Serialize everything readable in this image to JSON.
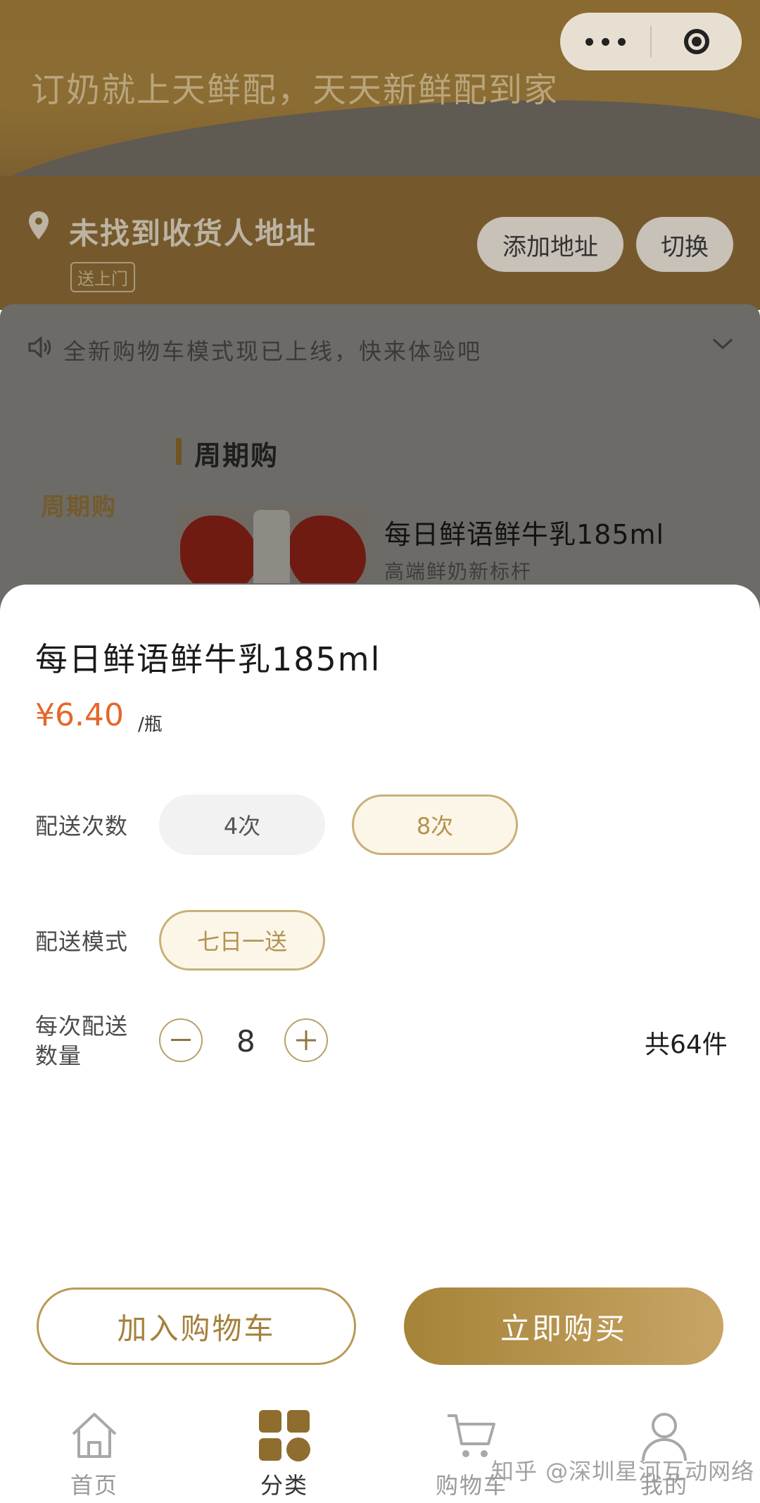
{
  "header": {
    "slogan": "订奶就上天鲜配，天天新鲜配到家",
    "capsule": {
      "more_icon": "more-dots-icon",
      "close_icon": "target-close-icon"
    }
  },
  "address": {
    "title": "未找到收货人地址",
    "tag": "送上门",
    "add_button": "添加地址",
    "switch_button": "切换"
  },
  "notice": {
    "text": "全新购物车模式现已上线，快来体验吧"
  },
  "category": {
    "left_item": "周期购",
    "section_title": "周期购",
    "product_name": "每日鲜语鲜牛乳185ml",
    "product_subtitle": "高端鲜奶新标杆"
  },
  "sheet": {
    "title": "每日鲜语鲜牛乳185ml",
    "price": "¥6.40",
    "unit": "/瓶",
    "delivery_times_label": "配送次数",
    "delivery_times_options": [
      {
        "label": "4次",
        "selected": false
      },
      {
        "label": "8次",
        "selected": true
      }
    ],
    "delivery_mode_label": "配送模式",
    "delivery_mode_option": "七日一送",
    "qty_label_line1": "每次配送",
    "qty_label_line2": "数量",
    "qty_value": "8",
    "qty_total": "共64件",
    "add_to_cart": "加入购物车",
    "buy_now": "立即购买"
  },
  "tabbar": {
    "items": [
      {
        "label": "首页",
        "icon": "home-icon",
        "active": false
      },
      {
        "label": "分类",
        "icon": "category-grid-icon",
        "active": true
      },
      {
        "label": "购物车",
        "icon": "cart-icon",
        "active": false
      },
      {
        "label": "我的",
        "icon": "user-icon",
        "active": false
      }
    ]
  },
  "watermark": "知乎 @深圳星河互动网络",
  "colors": {
    "accent": "#b39352",
    "price": "#e4672b",
    "buy_button": "#b8964f"
  }
}
